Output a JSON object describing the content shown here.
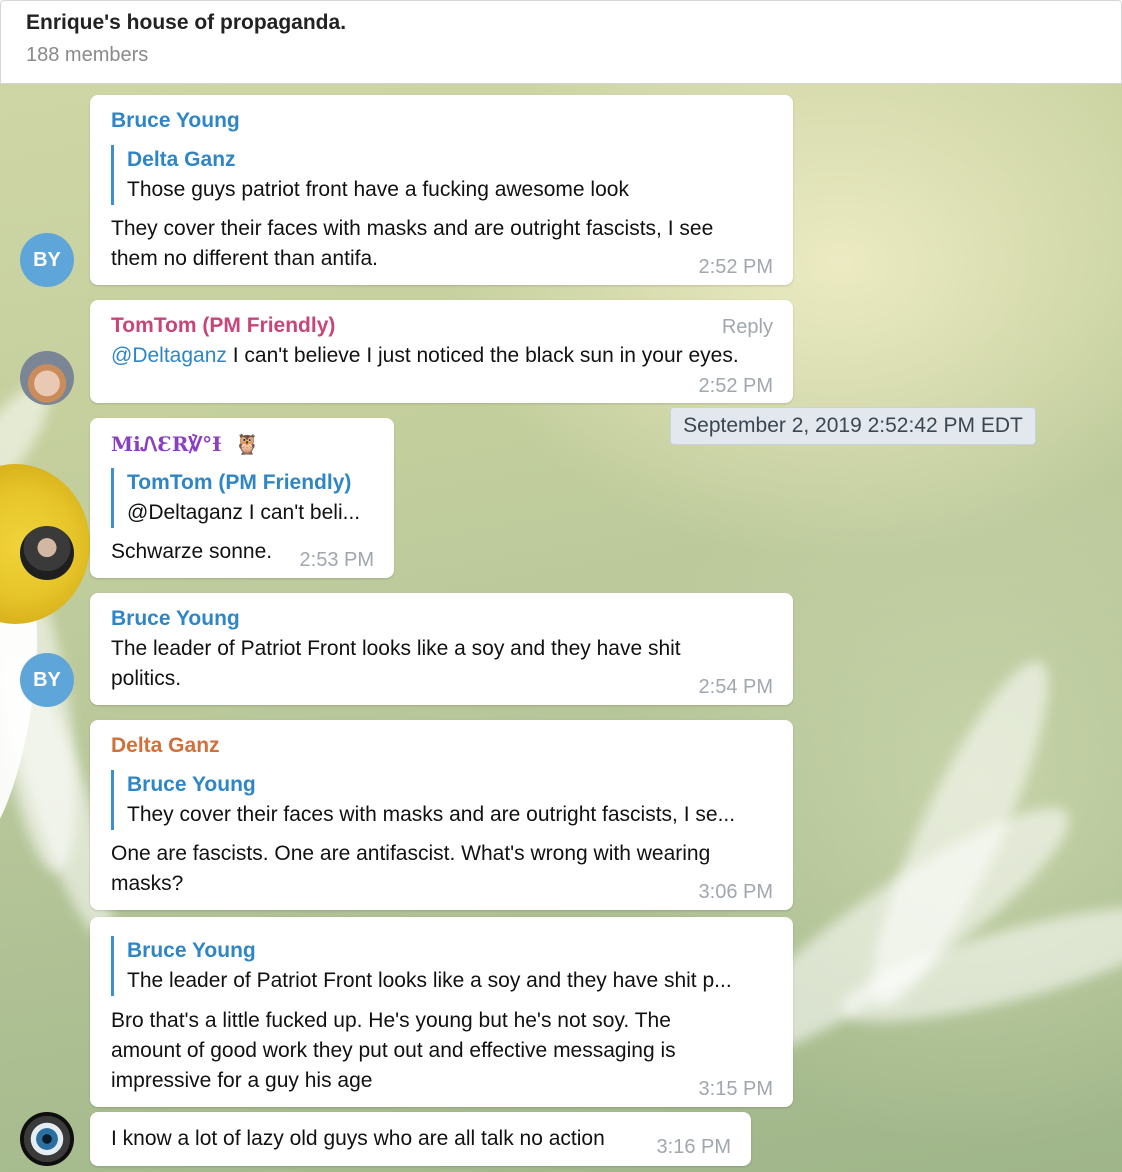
{
  "header": {
    "title": "Enrique's house of propaganda.",
    "subtitle": "188 members"
  },
  "date_tooltip": "September 2, 2019 2:52:42 PM EDT",
  "messages": [
    {
      "author": "Bruce Young",
      "author_color": "#2f86c7",
      "quote_author": "Delta Ganz",
      "quote_text": "Those guys patriot front have a fucking awesome look",
      "text_lines": [
        "They cover their faces with masks and are outright fascists, I see",
        "them no different than antifa."
      ],
      "time": "2:52 PM",
      "avatar": "BY"
    },
    {
      "author": "TomTom (PM Friendly)",
      "author_color": "#c8457a",
      "reply_label": "Reply",
      "mention": "@Deltaganz",
      "text": " I can't believe I just noticed the black sun in your eyes.",
      "time": "2:52 PM",
      "avatar_icon": "fox-avatar"
    },
    {
      "author": "MiᏁƐR℣°Ɨ",
      "author_color": "#8a3fc2",
      "author_emoji": "🦉",
      "quote_author": "TomTom (PM Friendly)",
      "quote_text": "@Deltaganz I can't beli...",
      "text": "Schwarze sonne.",
      "time": "2:53 PM",
      "avatar_icon": "bearded-man-avatar"
    },
    {
      "author": "Bruce Young",
      "author_color": "#2f86c7",
      "text_lines": [
        "The leader of Patriot Front looks like a soy and they have shit",
        "politics."
      ],
      "time": "2:54 PM",
      "avatar": "BY"
    },
    {
      "author": "Delta Ganz",
      "author_color": "#d0703a",
      "quote_author": "Bruce Young",
      "quote_text": "They cover their faces with masks and are outright fascists, I se...",
      "text_lines": [
        "One are fascists. One are antifascist. What's wrong with wearing",
        "masks?"
      ],
      "time": "3:06 PM"
    },
    {
      "quote_author": "Bruce Young",
      "quote_text": "The leader of Patriot Front looks like a soy and they have shit p...",
      "text_lines": [
        "Bro that's a little fucked up. He's young but he's not soy. The",
        "amount of good work they put out and effective messaging is",
        "impressive for a guy his age"
      ],
      "time": "3:15 PM"
    },
    {
      "text": "I know a lot of lazy old guys who are all talk no action",
      "time": "3:16 PM",
      "avatar_icon": "eye-avatar"
    }
  ]
}
